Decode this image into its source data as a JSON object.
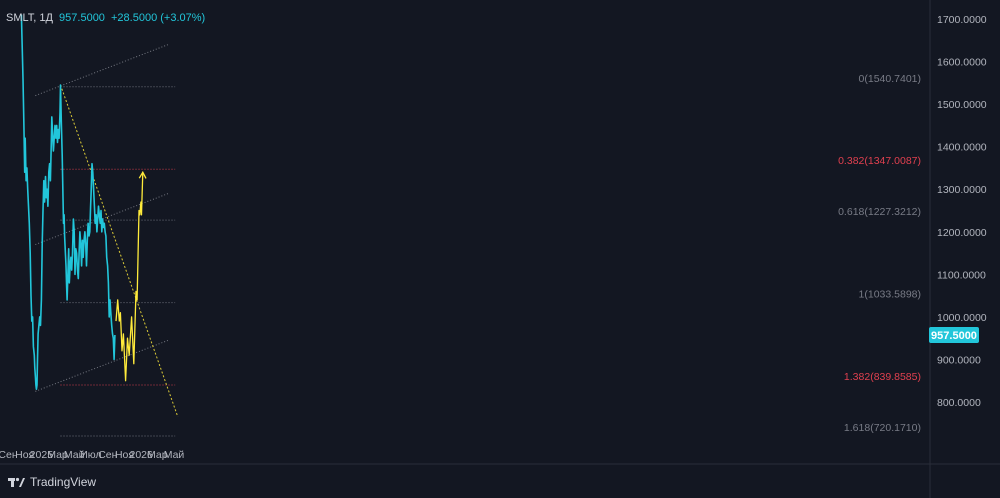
{
  "header": {
    "symbol": "SMLT, 1Д",
    "last_price": "957.5000",
    "change": "+28.5000 (+3.07%)"
  },
  "footer": {
    "logo_text": "TradingView"
  },
  "colors": {
    "background": "#131722",
    "price_line": "#22c6da",
    "projection": "#ffeb3b",
    "fib_gray": "#787b86",
    "fib_red": "#e0404f",
    "axis_text": "#b2b5be"
  },
  "chart_data": {
    "type": "line",
    "title": "",
    "xlabel": "",
    "ylabel": "",
    "ylim": [
      705,
      1740
    ],
    "x_tick_labels": [
      "Сен",
      "Ноя",
      "2025",
      "Мар",
      "Май",
      "Июл",
      "Сен",
      "Ноя",
      "2026",
      "Мар",
      "Май"
    ],
    "x_tick_dates": [
      "2024-09-01",
      "2024-11-01",
      "2025-01-01",
      "2025-03-01",
      "2025-05-01",
      "2025-07-01",
      "2025-09-01",
      "2025-11-01",
      "2026-01-01",
      "2026-03-01",
      "2026-05-01"
    ],
    "y_tick_labels": [
      "1700.0000",
      "1600.0000",
      "1500.0000",
      "1400.0000",
      "1300.0000",
      "1200.0000",
      "1100.0000",
      "1000.0000",
      "900.0000",
      "800.0000"
    ],
    "y_tick_values": [
      1700,
      1600,
      1500,
      1400,
      1300,
      1200,
      1100,
      1000,
      900,
      800
    ],
    "last_price_tag": {
      "value": 957.5,
      "label": "957.5000"
    },
    "series": [
      {
        "kind": "price",
        "points": [
          [
            "2024-10-20",
            1710
          ],
          [
            "2024-10-26",
            1560
          ],
          [
            "2024-10-29",
            1450
          ],
          [
            "2024-11-01",
            1340
          ],
          [
            "2024-11-03",
            1420
          ],
          [
            "2024-11-06",
            1320
          ],
          [
            "2024-11-09",
            1350
          ],
          [
            "2024-11-12",
            1300
          ],
          [
            "2024-11-15",
            1260
          ],
          [
            "2024-11-18",
            1220
          ],
          [
            "2024-11-21",
            1150
          ],
          [
            "2024-11-24",
            1050
          ],
          [
            "2024-11-27",
            990
          ],
          [
            "2024-11-30",
            1000
          ],
          [
            "2024-12-03",
            930
          ],
          [
            "2024-12-06",
            910
          ],
          [
            "2024-12-08",
            880
          ],
          [
            "2024-12-10",
            860
          ],
          [
            "2024-12-12",
            840
          ],
          [
            "2024-12-14",
            830
          ],
          [
            "2024-12-16",
            840
          ],
          [
            "2024-12-18",
            900
          ],
          [
            "2024-12-20",
            960
          ],
          [
            "2024-12-23",
            980
          ],
          [
            "2024-12-26",
            1000
          ],
          [
            "2024-12-29",
            980
          ],
          [
            "2025-01-01",
            1040
          ],
          [
            "2025-01-04",
            1170
          ],
          [
            "2025-01-07",
            1250
          ],
          [
            "2025-01-10",
            1320
          ],
          [
            "2025-01-13",
            1270
          ],
          [
            "2025-01-16",
            1330
          ],
          [
            "2025-01-19",
            1280
          ],
          [
            "2025-01-22",
            1300
          ],
          [
            "2025-01-25",
            1260
          ],
          [
            "2025-01-28",
            1340
          ],
          [
            "2025-01-31",
            1360
          ],
          [
            "2025-02-03",
            1320
          ],
          [
            "2025-02-06",
            1400
          ],
          [
            "2025-02-08",
            1470
          ],
          [
            "2025-02-11",
            1430
          ],
          [
            "2025-02-14",
            1390
          ],
          [
            "2025-02-17",
            1420
          ],
          [
            "2025-02-20",
            1450
          ],
          [
            "2025-02-23",
            1420
          ],
          [
            "2025-02-26",
            1450
          ],
          [
            "2025-03-01",
            1410
          ],
          [
            "2025-03-04",
            1440
          ],
          [
            "2025-03-07",
            1420
          ],
          [
            "2025-03-10",
            1480
          ],
          [
            "2025-03-12",
            1545
          ],
          [
            "2025-03-15",
            1460
          ],
          [
            "2025-03-18",
            1380
          ],
          [
            "2025-03-21",
            1280
          ],
          [
            "2025-03-23",
            1220
          ],
          [
            "2025-03-25",
            1240
          ],
          [
            "2025-03-27",
            1190
          ],
          [
            "2025-03-30",
            1150
          ],
          [
            "2025-04-01",
            1120
          ],
          [
            "2025-04-03",
            1080
          ],
          [
            "2025-04-05",
            1040
          ],
          [
            "2025-04-08",
            1100
          ],
          [
            "2025-04-11",
            1160
          ],
          [
            "2025-04-13",
            1080
          ],
          [
            "2025-04-16",
            1120
          ],
          [
            "2025-04-19",
            1140
          ],
          [
            "2025-04-22",
            1110
          ],
          [
            "2025-04-25",
            1150
          ],
          [
            "2025-04-28",
            1230
          ],
          [
            "2025-05-01",
            1200
          ],
          [
            "2025-05-04",
            1100
          ],
          [
            "2025-05-07",
            1160
          ],
          [
            "2025-05-10",
            1150
          ],
          [
            "2025-05-13",
            1110
          ],
          [
            "2025-05-16",
            1090
          ],
          [
            "2025-05-19",
            1150
          ],
          [
            "2025-05-22",
            1200
          ],
          [
            "2025-05-25",
            1170
          ],
          [
            "2025-05-28",
            1120
          ],
          [
            "2025-05-31",
            1180
          ],
          [
            "2025-06-03",
            1140
          ],
          [
            "2025-06-06",
            1180
          ],
          [
            "2025-06-09",
            1200
          ],
          [
            "2025-06-12",
            1170
          ],
          [
            "2025-06-15",
            1120
          ],
          [
            "2025-06-18",
            1180
          ],
          [
            "2025-06-21",
            1220
          ],
          [
            "2025-06-24",
            1190
          ],
          [
            "2025-06-27",
            1200
          ],
          [
            "2025-06-30",
            1260
          ],
          [
            "2025-07-02",
            1290
          ],
          [
            "2025-07-05",
            1360
          ],
          [
            "2025-07-08",
            1340
          ],
          [
            "2025-07-11",
            1300
          ],
          [
            "2025-07-14",
            1260
          ],
          [
            "2025-07-17",
            1220
          ],
          [
            "2025-07-20",
            1240
          ],
          [
            "2025-07-23",
            1200
          ],
          [
            "2025-07-26",
            1230
          ],
          [
            "2025-07-29",
            1260
          ],
          [
            "2025-08-01",
            1240
          ],
          [
            "2025-08-04",
            1220
          ],
          [
            "2025-08-07",
            1250
          ],
          [
            "2025-08-10",
            1200
          ],
          [
            "2025-08-13",
            1230
          ],
          [
            "2025-08-16",
            1210
          ],
          [
            "2025-08-19",
            1220
          ],
          [
            "2025-08-22",
            1200
          ],
          [
            "2025-08-25",
            1190
          ],
          [
            "2025-08-28",
            1140
          ],
          [
            "2025-08-31",
            1120
          ],
          [
            "2025-09-03",
            1080
          ],
          [
            "2025-09-06",
            1000
          ],
          [
            "2025-09-09",
            1040
          ],
          [
            "2025-09-12",
            1010
          ],
          [
            "2025-09-15",
            980
          ],
          [
            "2025-09-18",
            960
          ],
          [
            "2025-09-21",
            950
          ],
          [
            "2025-09-24",
            900
          ],
          [
            "2025-09-27",
            957.5
          ]
        ]
      },
      {
        "kind": "projection",
        "points": [
          [
            "2025-10-01",
            990
          ],
          [
            "2025-10-07",
            1040
          ],
          [
            "2025-10-13",
            990
          ],
          [
            "2025-10-17",
            1010
          ],
          [
            "2025-10-23",
            920
          ],
          [
            "2025-10-28",
            960
          ],
          [
            "2025-11-05",
            850
          ],
          [
            "2025-11-12",
            950
          ],
          [
            "2025-11-18",
            910
          ],
          [
            "2025-11-27",
            1000
          ],
          [
            "2025-12-05",
            890
          ],
          [
            "2025-12-13",
            1060
          ],
          [
            "2025-12-17",
            1040
          ],
          [
            "2025-12-24",
            1250
          ],
          [
            "2025-12-27",
            1240
          ],
          [
            "2025-12-31",
            1270
          ],
          [
            "2026-01-02",
            1240
          ],
          [
            "2026-01-07",
            1340
          ]
        ]
      }
    ],
    "trend_lines": [
      {
        "kind": "channel",
        "from": [
          "2024-12-10",
          1520
        ],
        "to": [
          "2026-04-10",
          1640
        ]
      },
      {
        "kind": "channel",
        "from": [
          "2024-12-10",
          1170
        ],
        "to": [
          "2026-04-10",
          1290
        ]
      },
      {
        "kind": "channel",
        "from": [
          "2024-12-10",
          825
        ],
        "to": [
          "2026-04-10",
          945
        ]
      },
      {
        "kind": "downtrend",
        "from": [
          "2025-03-12",
          1545
        ],
        "to": [
          "2026-05-15",
          765
        ]
      }
    ],
    "fib_levels": [
      {
        "label": "0(1540.7401)",
        "value": 1540.7401,
        "color": "gray"
      },
      {
        "label": "0.382(1347.0087)",
        "value": 1347.0087,
        "color": "red"
      },
      {
        "label": "0.618(1227.3212)",
        "value": 1227.3212,
        "color": "gray"
      },
      {
        "label": "1(1033.5898)",
        "value": 1033.5898,
        "color": "gray"
      },
      {
        "label": "1.382(839.8585)",
        "value": 839.8585,
        "color": "red"
      },
      {
        "label": "1.618(720.1710)",
        "value": 720.171,
        "color": "gray"
      }
    ],
    "fib_range": {
      "from": "2025-03-12",
      "to": "2026-05-05"
    },
    "grid": false,
    "legend": "top-left"
  }
}
